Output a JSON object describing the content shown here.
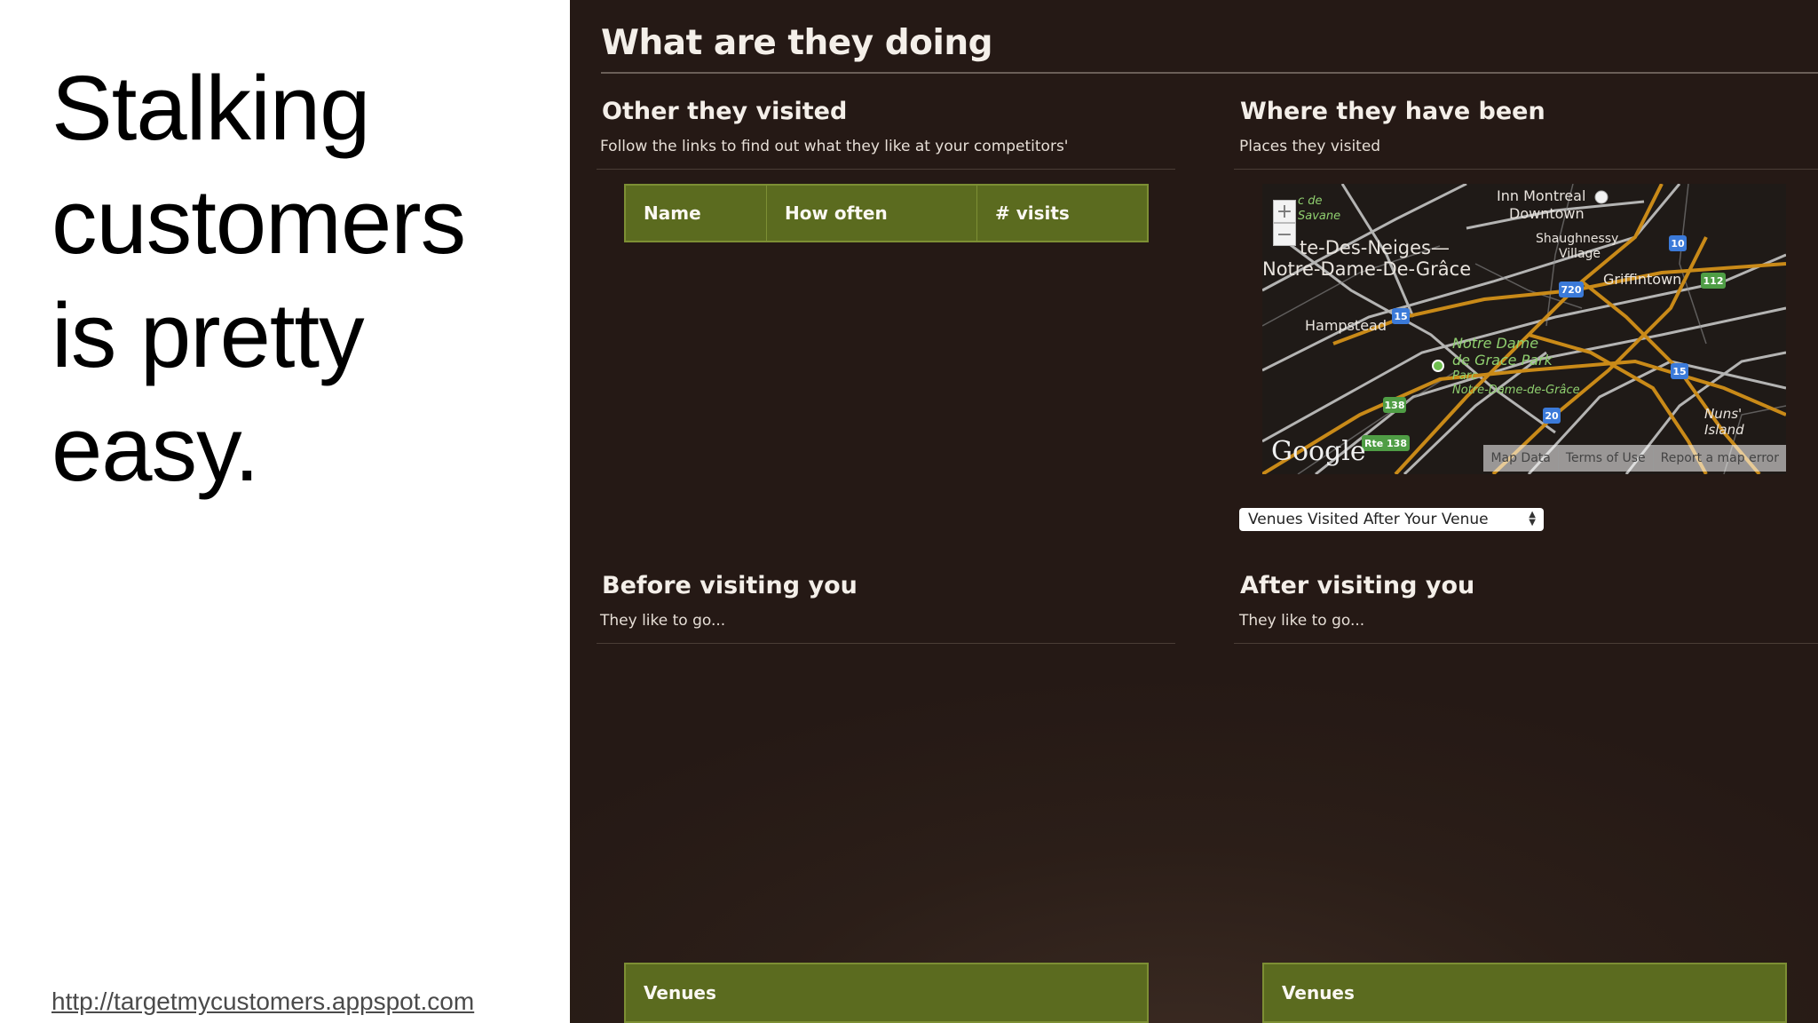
{
  "slide": {
    "title_lines": [
      "Stalking",
      "customers",
      "is pretty",
      "easy."
    ],
    "link": "http://targetmycustomers.appspot.com"
  },
  "screenshot": {
    "heading": "What are they doing",
    "other_visited": {
      "title": "Other they visited",
      "subtitle": "Follow the links to find out what they like at your competitors'",
      "columns": [
        "Name",
        "How often",
        "# visits"
      ]
    },
    "where_been": {
      "title": "Where they have been",
      "subtitle": "Places they visited",
      "map": {
        "labels": {
          "inn": "Inn Montreal",
          "downtown": "Downtown",
          "neiges": "te-Des-Neiges—",
          "ndg": "Notre-Dame-De-Grâce",
          "shaughnessy": "Shaughnessy",
          "village": "Village",
          "griffintown": "Griffintown",
          "hampstead": "Hampstead",
          "park1": "Notre Dame",
          "park2": "de Grace Park",
          "parc1": "Parc",
          "parc2": "Notre-Dame-de-Grâce",
          "nuns1": "Nuns'",
          "nuns2": "Island",
          "savane1": "c de",
          "savane2": "Savane"
        },
        "highways": [
          "10",
          "112",
          "720",
          "15",
          "15",
          "138",
          "20",
          "Rte 138"
        ],
        "zoom_in": "+",
        "zoom_out": "−",
        "logo": "Google",
        "footer": [
          "Map Data",
          "Terms of Use",
          "Report a map error"
        ]
      },
      "select_value": "Venues Visited After Your Venue"
    },
    "before": {
      "title": "Before visiting you",
      "subtitle": "They like to go...",
      "table_header": "Venues"
    },
    "after": {
      "title": "After visiting you",
      "subtitle": "They like to go...",
      "table_header": "Venues"
    },
    "colors": {
      "background": "#2b1e18",
      "table_header_green": "#5b6b1f",
      "map_road_orange": "#c98a18"
    }
  }
}
